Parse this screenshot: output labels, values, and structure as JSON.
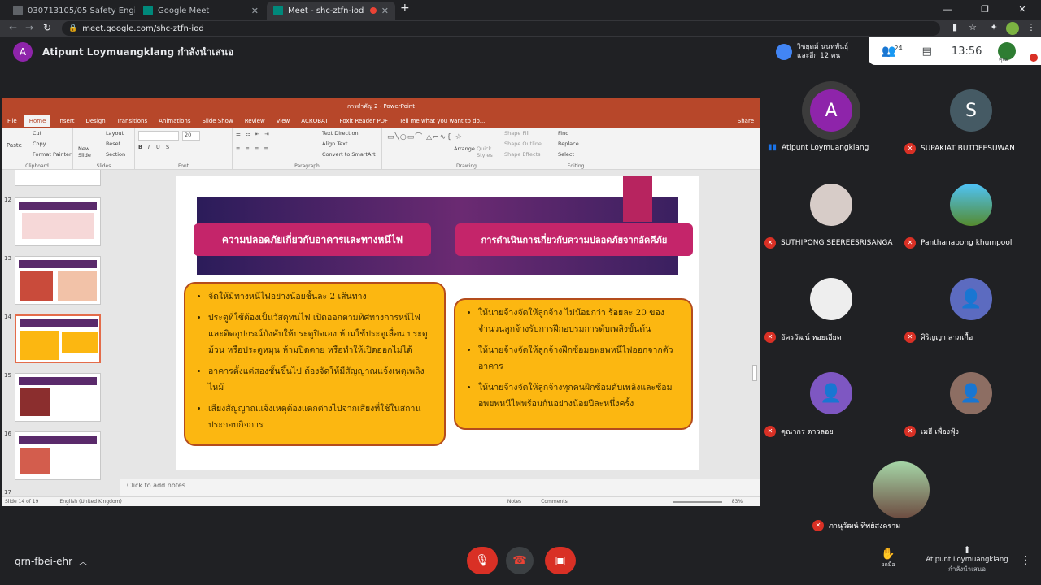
{
  "browser": {
    "tabs": [
      {
        "title": "030713105/05 Safety Engineerin",
        "active": false
      },
      {
        "title": "Google Meet",
        "active": false
      },
      {
        "title": "Meet - shc-ztfn-iod",
        "active": true
      }
    ],
    "new_tab_label": "+",
    "url": "meet.google.com/shc-ztfn-iod"
  },
  "meet": {
    "presenter_initial": "A",
    "presenter_label": "Atipunt Loymuangklang กำลังนำเสนอ",
    "people_label": "วิชยุตม์ นนทพันธุ์\nและอีก 12 คน",
    "participant_count": "24",
    "clock": "13:56",
    "you_label": "คุณ",
    "meeting_code": "qrn-fbei-ehr",
    "raise_hand_label": "ยกมือ",
    "presenting_footer_name": "Atipunt Loymuangklang",
    "presenting_footer_sub": "กำลังนำเสนอ",
    "participants": [
      {
        "name": "Atipunt Loymuangklang",
        "initial": "A",
        "color": "#8e24aa",
        "muted": false
      },
      {
        "name": "SUPAKIAT BUTDEESUWAN",
        "initial": "S",
        "color": "#455a64",
        "muted": true
      },
      {
        "name": "SUTHIPONG SEEREESRISANGA",
        "initial": "",
        "color": "#d7ccc8",
        "muted": true
      },
      {
        "name": "Panthanapong khumpool",
        "initial": "",
        "color": "#4fc3f7",
        "muted": true
      },
      {
        "name": "อัครวัฒน์ หอยเอียด",
        "initial": "",
        "color": "#eeeeee",
        "muted": true
      },
      {
        "name": "ศิริญญา ลาภเกื้อ",
        "initial": "",
        "color": "#5c6bc0",
        "muted": true
      },
      {
        "name": "คุณากร ดาวลอย",
        "initial": "",
        "color": "#7e57c2",
        "muted": true
      },
      {
        "name": "เมธี เพื่องฟุ้ง",
        "initial": "",
        "color": "#8d6e63",
        "muted": true
      },
      {
        "name": "ภานุวัฒน์ ทิพย์สงคราม",
        "initial": "",
        "color": "#a5d6a7",
        "muted": true
      }
    ]
  },
  "ppt": {
    "window_title": "การสำคัญ 2 - PowerPoint",
    "ribbon_tabs": [
      "File",
      "Home",
      "Insert",
      "Design",
      "Transitions",
      "Animations",
      "Slide Show",
      "Review",
      "View",
      "ACROBAT",
      "Foxit Reader PDF",
      "Tell me what you want to do..."
    ],
    "share_label": "Share",
    "groups": {
      "clipboard": "Clipboard",
      "slides": "Slides",
      "font": "Font",
      "paragraph": "Paragraph",
      "drawing": "Drawing",
      "editing": "Editing"
    },
    "clipboard_items": [
      "Paste",
      "Cut",
      "Copy",
      "Format Painter"
    ],
    "slides_items": [
      "New Slide",
      "Layout",
      "Reset",
      "Section"
    ],
    "font_size": "20",
    "paragraph_items": [
      "Text Direction",
      "Align Text",
      "Convert to SmartArt"
    ],
    "drawing_items": [
      "Arrange",
      "Quick Styles",
      "Shape Fill",
      "Shape Outline",
      "Shape Effects"
    ],
    "editing_items": [
      "Find",
      "Replace",
      "Select"
    ],
    "thumb_numbers": [
      "12",
      "13",
      "14",
      "15",
      "16",
      "17"
    ],
    "notes_placeholder": "Click to add notes",
    "status_left": "Slide 14 of 19",
    "status_lang": "English (United Kingdom)",
    "status_notes": "Notes",
    "status_comments": "Comments",
    "zoom": "83%"
  },
  "slide": {
    "heading_left": "ความปลอดภัยเกี่ยวกับอาคารและทางหนีไฟ",
    "heading_right": "การดำเนินการเกี่ยวกับความปลอดภัยจากอัคคีภัย",
    "left_items": [
      "จัดให้มีทางหนีไฟอย่างน้อยชั้นละ 2 เส้นทาง",
      "ประตูที่ใช้ต้องเป็นวัสดุทนไฟ เปิดออกตามทิศทางการหนีไฟ และติดอุปกรณ์บังคับให้ประตูปิดเอง ห้ามใช้ประตูเลื่อน ประตูม้วน หรือประตูหมุน ห้ามปิดตาย หรือทำให้เปิดออกไม่ได้",
      "อาคารตั้งแต่สองชั้นขึ้นไป ต้องจัดให้มีสัญญาณแจ้งเหตุเพลิงไหม้",
      "เสียงสัญญาณแจ้งเหตุต้องแตกต่างไปจากเสียงที่ใช้ในสถานประกอบกิจการ"
    ],
    "right_items": [
      "ให้นายจ้างจัดให้ลูกจ้าง ไม่น้อยกว่า ร้อยละ 20 ของจำนวนลูกจ้างรับการฝึกอบรมการดับเพลิงขั้นต้น",
      "ให้นายจ้างจัดให้ลูกจ้างฝึกซ้อมอพยพหนีไฟออกจากตัวอาคาร",
      "ให้นายจ้างจัดให้ลูกจ้างทุกคนฝึกซ้อมดับเพลิงและซ้อมอพยพหนีไฟพร้อมกันอย่างน้อยปีละหนึ่งครั้ง"
    ]
  }
}
